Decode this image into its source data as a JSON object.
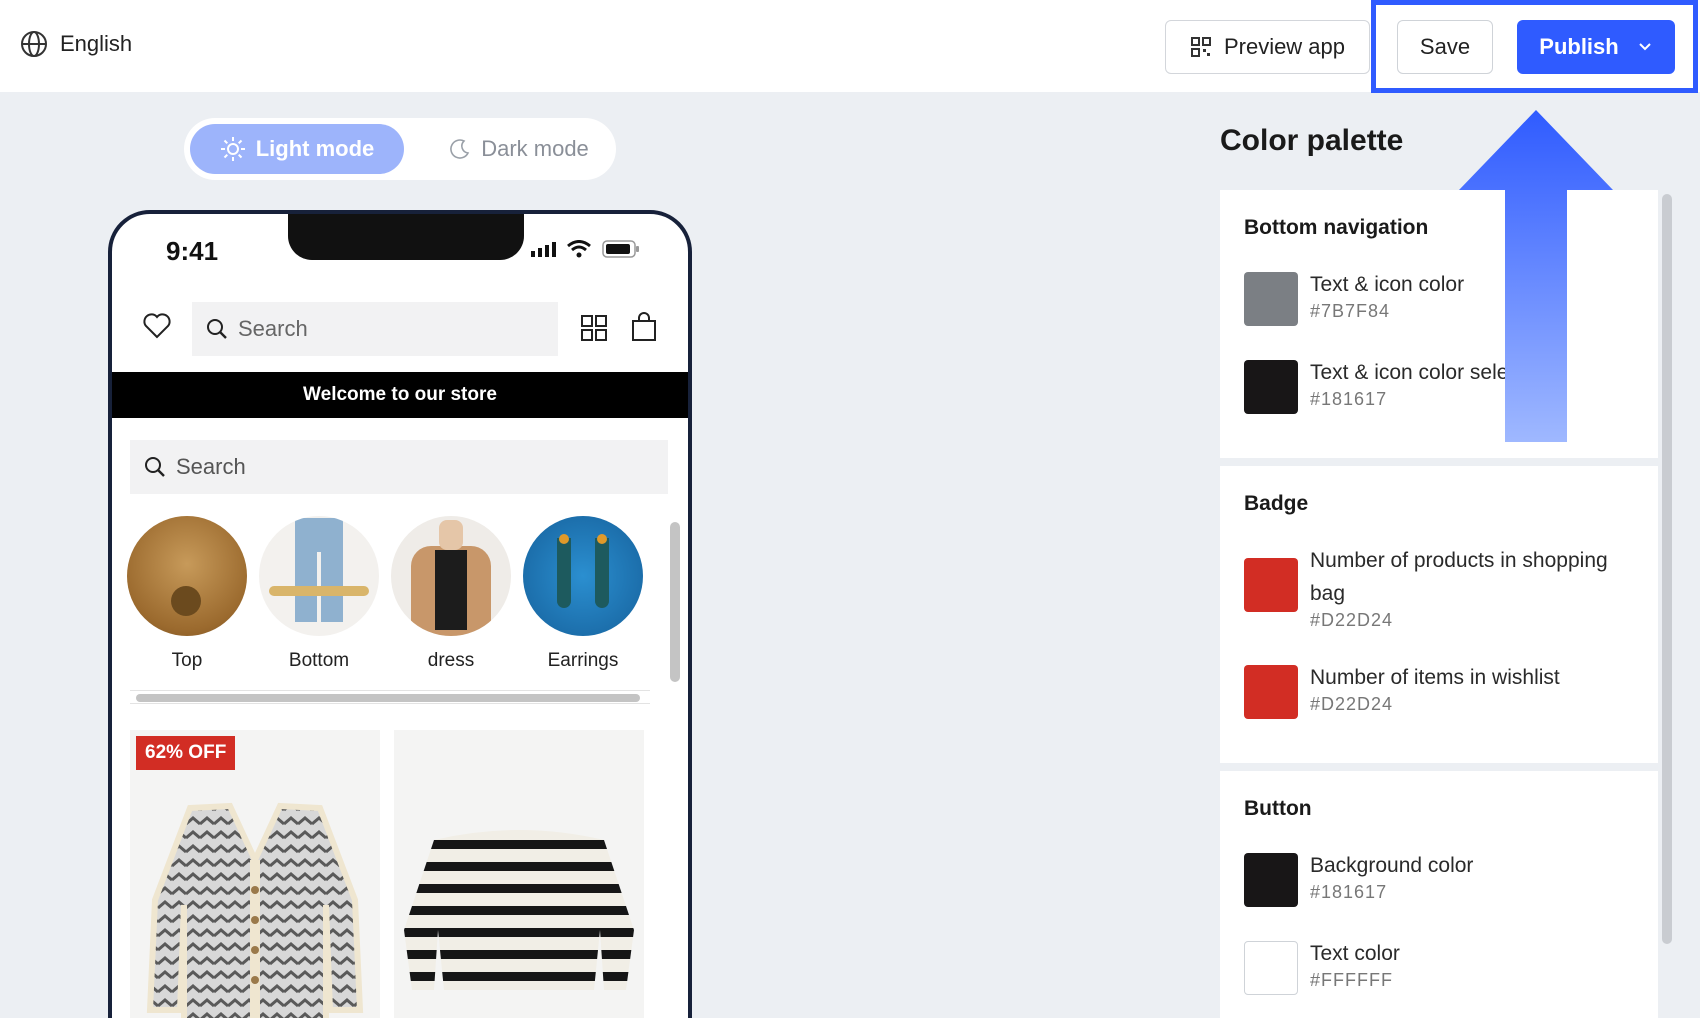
{
  "topbar": {
    "language": "English",
    "preview_label": "Preview app",
    "save_label": "Save",
    "publish_label": "Publish"
  },
  "mode_toggle": {
    "light_label": "Light mode",
    "dark_label": "Dark mode",
    "selected": "Light mode"
  },
  "phone": {
    "time": "9:41",
    "search_placeholder": "Search",
    "banner": "Welcome to our store",
    "search2_placeholder": "Search",
    "categories": [
      {
        "label": "Top"
      },
      {
        "label": "Bottom"
      },
      {
        "label": "dress"
      },
      {
        "label": "Earrings"
      }
    ],
    "products": [
      {
        "badge": "62% OFF"
      },
      {
        "badge": ""
      }
    ]
  },
  "color_palette": {
    "title": "Color palette",
    "sections": [
      {
        "title": "Bottom navigation",
        "items": [
          {
            "name": "Text & icon color",
            "hex": "#7B7F84",
            "color": "#7b7f84"
          },
          {
            "name": "Text & icon color selected",
            "hex": "#181617",
            "color": "#181617"
          }
        ]
      },
      {
        "title": "Badge",
        "items": [
          {
            "name": "Number of products in shopping bag",
            "hex": "#D22D24",
            "color": "#d22d24"
          },
          {
            "name": "Number of items in wishlist",
            "hex": "#D22D24",
            "color": "#d22d24"
          }
        ]
      },
      {
        "title": "Button",
        "items": [
          {
            "name": "Background color",
            "hex": "#181617",
            "color": "#181617"
          },
          {
            "name": "Text color",
            "hex": "#FFFFFF",
            "color": "#ffffff"
          }
        ]
      }
    ]
  },
  "colors": {
    "accent": "#2f5bff",
    "light_mode_pill": "#9db4fb"
  }
}
